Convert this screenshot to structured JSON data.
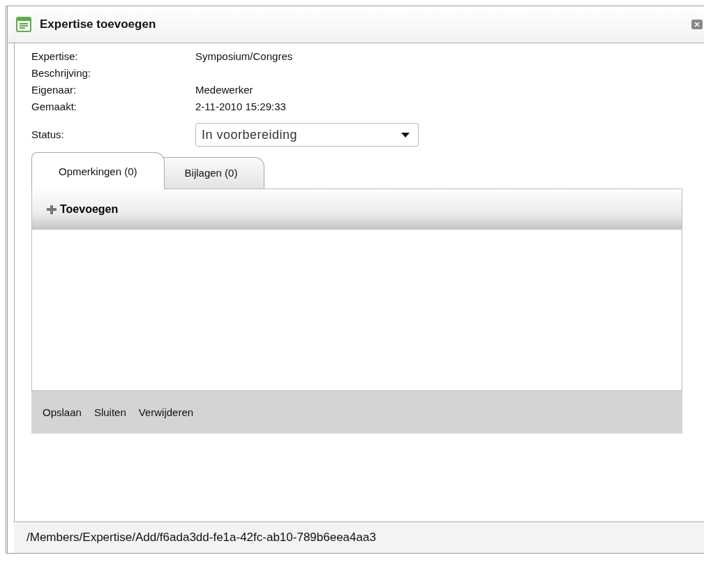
{
  "window": {
    "title": "Expertise toevoegen"
  },
  "fields": [
    {
      "label": "Expertise:",
      "value": "Symposium/Congres"
    },
    {
      "label": "Beschrijving:"
    },
    {
      "label": "Eigenaar:",
      "value": "Medewerker"
    },
    {
      "label": "Gemaakt:",
      "value": "2-11-2010 15:29:33"
    }
  ],
  "status": {
    "label": "Status:",
    "value": "In voorbereiding"
  },
  "tabs": [
    {
      "label": "Opmerkingen (0)",
      "selected": true
    },
    {
      "label": "Bijlagen (0)",
      "selected": false
    }
  ],
  "toolbar": {
    "add_button": "Toevoegen"
  },
  "buttons": [
    "Opslaan",
    "Sluiten",
    "Verwijderen"
  ],
  "status_bar": "/Members/Expertise/Add/f6ada3dd-fe1a-42fc-ab10-789b6eea4aa3"
}
